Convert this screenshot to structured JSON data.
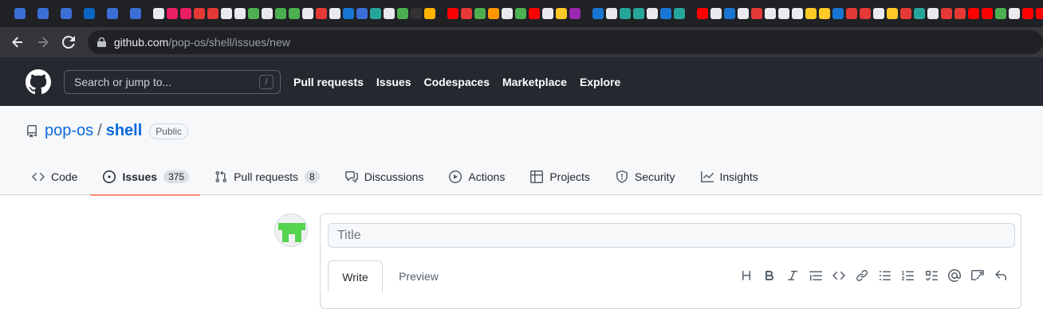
{
  "browser": {
    "url_host": "github.com",
    "url_path": "/pop-os/shell/issues/new",
    "bookmark_colors": [
      "#3b6fd6",
      "#3b6fd6",
      "#3b6fd6",
      "#0a66c2",
      "#3b6fd6",
      "#3b6fd6",
      "#e8eaed",
      "#e91e63",
      "#e91e63",
      "#e53935",
      "#e53935",
      "#e8eaed",
      "#e8eaed",
      "#4caf50",
      "#e8eaed",
      "#4caf50",
      "#4caf50",
      "#e8eaed",
      "#e53935",
      "#e8eaed",
      "#1976d2",
      "#3b6fd6",
      "#26a69a",
      "#e8eaed",
      "#4caf50",
      "#333333",
      "#ffb300",
      "#ff0000",
      "#e53935",
      "#4caf50",
      "#ff9800",
      "#e8eaed",
      "#4caf50",
      "#ff0000",
      "#e8eaed",
      "#ffca28",
      "#9c27b0",
      "#1976d2",
      "#e8eaed",
      "#26a69a",
      "#26a69a",
      "#e8eaed",
      "#1976d2",
      "#26a69a",
      "#ff0000",
      "#e8eaed",
      "#1976d2",
      "#e8eaed",
      "#e53935",
      "#e8eaed",
      "#e8eaed",
      "#e8eaed",
      "#ffca28",
      "#ffca28",
      "#1976d2",
      "#e53935",
      "#e53935",
      "#e8eaed",
      "#ffca28",
      "#e53935",
      "#26a69a",
      "#e8eaed",
      "#e53935",
      "#e53935",
      "#ff0000",
      "#ff0000",
      "#4caf50",
      "#e8eaed",
      "#ff0000",
      "#ff0000",
      "#ff0000"
    ]
  },
  "header": {
    "search_placeholder": "Search or jump to...",
    "search_key": "/",
    "nav": [
      "Pull requests",
      "Issues",
      "Codespaces",
      "Marketplace",
      "Explore"
    ]
  },
  "repo": {
    "owner": "pop-os",
    "separator": "/",
    "name": "shell",
    "visibility": "Public"
  },
  "tabs": [
    {
      "label": "Code",
      "icon": "code-icon"
    },
    {
      "label": "Issues",
      "count": "375",
      "icon": "issue-opened-icon",
      "active": true
    },
    {
      "label": "Pull requests",
      "count": "8",
      "icon": "git-pull-request-icon"
    },
    {
      "label": "Discussions",
      "icon": "comment-discussion-icon"
    },
    {
      "label": "Actions",
      "icon": "play-icon"
    },
    {
      "label": "Projects",
      "icon": "table-icon"
    },
    {
      "label": "Security",
      "icon": "shield-icon"
    },
    {
      "label": "Insights",
      "icon": "graph-icon"
    }
  ],
  "form": {
    "title_placeholder": "Title",
    "write_tab": "Write",
    "preview_tab": "Preview",
    "toolbar": [
      "heading-icon",
      "bold-icon",
      "italic-icon",
      "quote-icon",
      "code-icon",
      "link-icon",
      "unordered-list-icon",
      "ordered-list-icon",
      "task-list-icon",
      "mention-icon",
      "reference-icon",
      "reply-icon"
    ]
  },
  "colors": {
    "accent": "#0969da",
    "active_underline": "#fd8c73",
    "header_bg": "#24292f",
    "avatar_green": "#55d44f"
  }
}
